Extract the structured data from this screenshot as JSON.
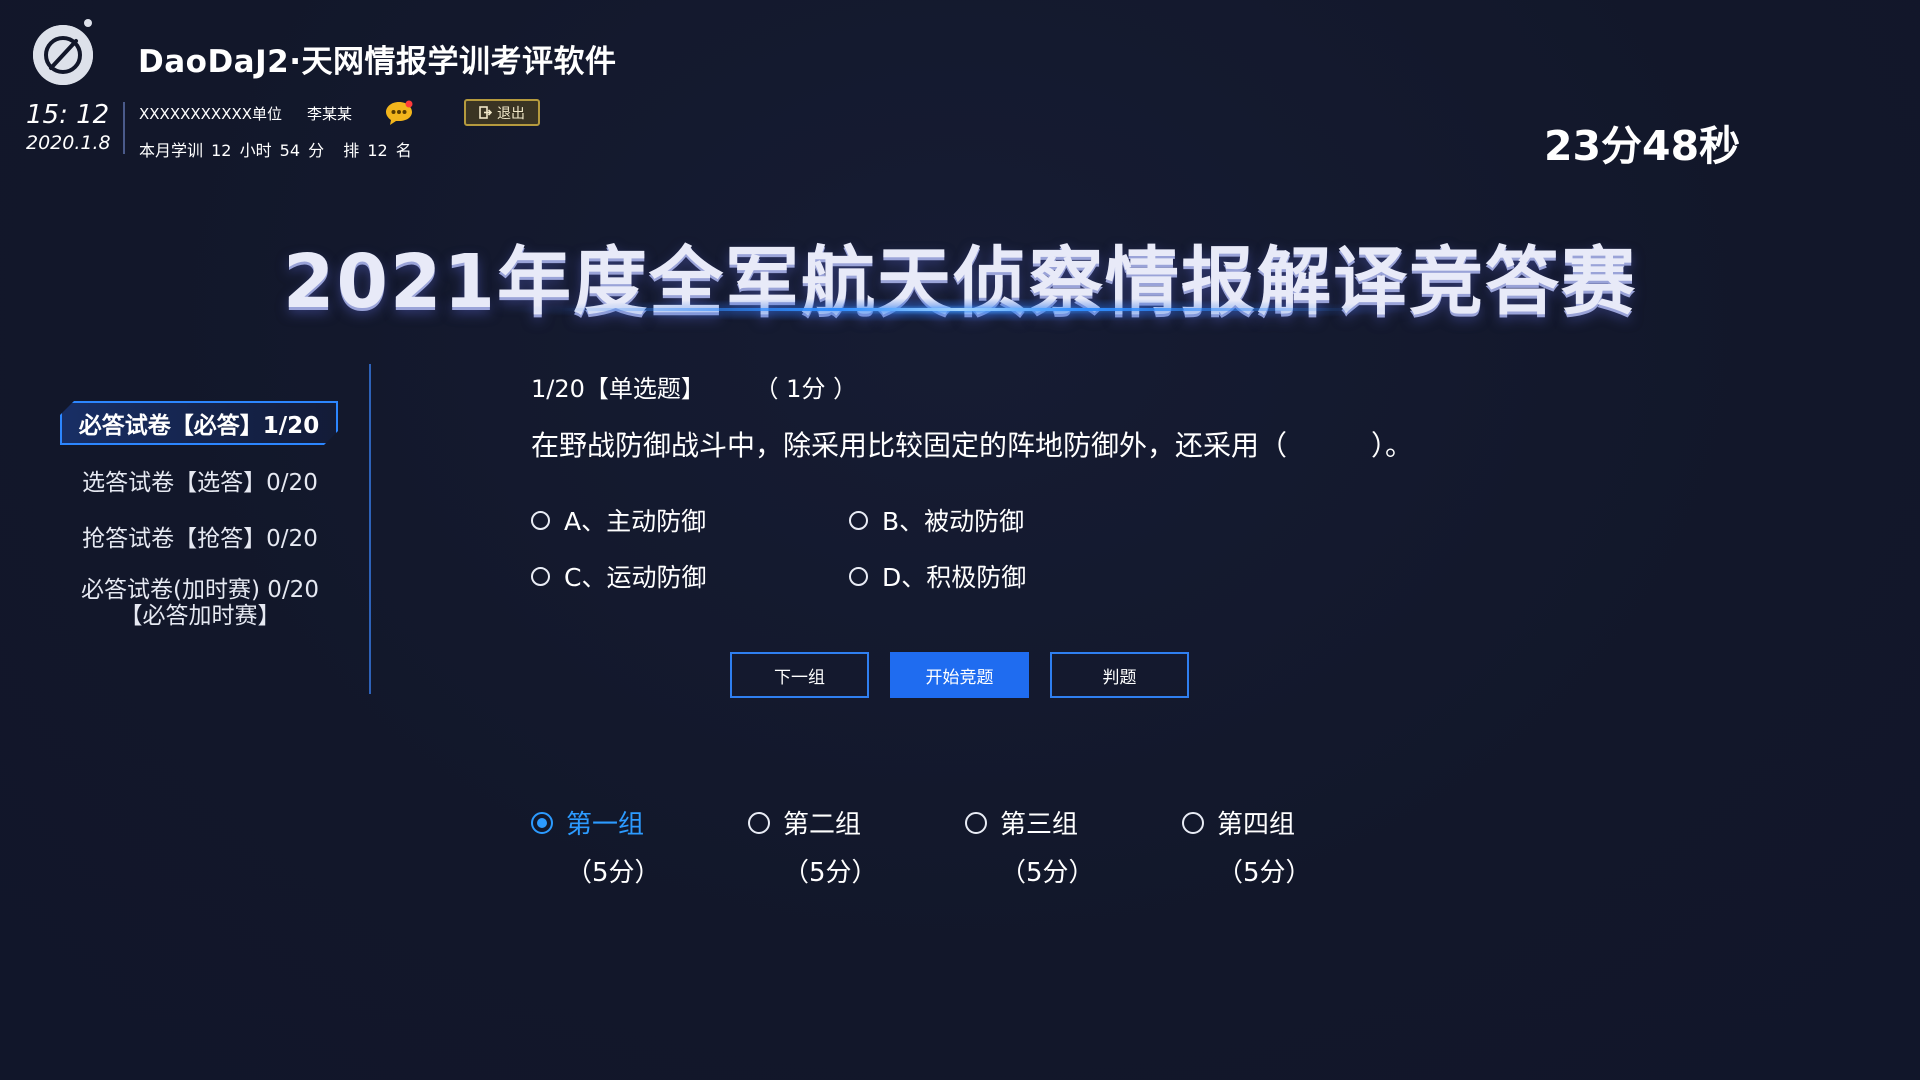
{
  "header": {
    "app_title": "DaoDaJ2·天网情报学训考评软件",
    "time": "15: 12",
    "date": "2020.1.8",
    "unit": "XXXXXXXXXXX单位",
    "user": "李某某",
    "logout_label": "退出",
    "monthly_prefix": "本月学训",
    "monthly_hours": "12",
    "monthly_hours_unit": "小时",
    "monthly_minutes": "54",
    "monthly_minutes_unit": "分",
    "rank_prefix": "排",
    "rank_value": "12",
    "rank_unit": "名",
    "timer": "23分48秒"
  },
  "main_title": "2021年度全军航天侦察情报解译竞答赛",
  "menu": {
    "items": [
      {
        "label": "必答试卷【必答】1/20"
      },
      {
        "label": "选答试卷【选答】0/20"
      },
      {
        "label": "抢答试卷【抢答】0/20"
      },
      {
        "label_line1": "必答试卷(加时赛) 0/20",
        "label_line2": "【必答加时赛】"
      }
    ]
  },
  "question": {
    "number": "1/20【单选题】",
    "score": "（ 1分 ）",
    "text": "在野战防御战斗中，除采用比较固定的阵地防御外，还采用（　　　）。",
    "options": [
      {
        "label": "A、主动防御"
      },
      {
        "label": "B、被动防御"
      },
      {
        "label": "C、运动防御"
      },
      {
        "label": "D、积极防御"
      }
    ]
  },
  "buttons": {
    "next_group": "下一组",
    "start": "开始竞题",
    "judge": "判题"
  },
  "groups": [
    {
      "name": "第一组",
      "score": "（5分）",
      "selected": true
    },
    {
      "name": "第二组",
      "score": "（5分）",
      "selected": false
    },
    {
      "name": "第三组",
      "score": "（5分）",
      "selected": false
    },
    {
      "name": "第四组",
      "score": "（5分）",
      "selected": false
    }
  ],
  "colors": {
    "background": "#12172a",
    "accent_blue": "#2c9bff",
    "button_primary": "#1f6cf0",
    "logout_border": "#b59a3e",
    "message_icon": "#f2b51c",
    "notification_dot": "#ff3b3b"
  },
  "icons": {
    "logo": "planet-logo-icon",
    "message": "chat-bubble-icon",
    "logout": "logout-icon"
  }
}
